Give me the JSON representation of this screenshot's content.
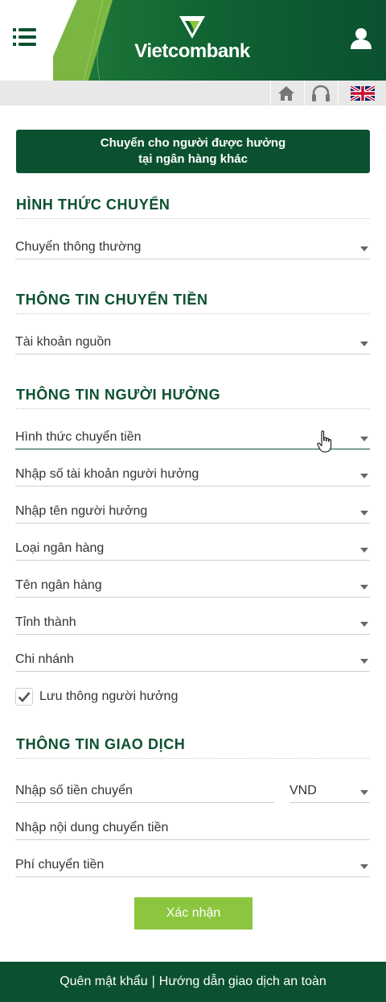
{
  "header": {
    "brand": "Vietcombank",
    "colors": {
      "primary_green": "#0b5130",
      "accent_green": "#8cc63e",
      "toolbar_gray": "#e8e8e8"
    },
    "icons": {
      "menu": "menu-list-icon",
      "user": "user-icon",
      "logo": "vietcombank-logo-mark"
    }
  },
  "toolbar": {
    "icons": {
      "home": "home-icon",
      "support": "headset-icon",
      "language": "uk-flag-icon"
    }
  },
  "page": {
    "title_line1": "Chuyển cho người được hưởng",
    "title_line2": "tại ngân hàng khác"
  },
  "sections": {
    "transfer_type": {
      "title": "HÌNH THỨC CHUYỂN",
      "select_value": "Chuyển thông thường"
    },
    "transfer_info": {
      "title": "THÔNG TIN CHUYỂN TIỀN",
      "source_account": "Tài khoản nguồn"
    },
    "beneficiary": {
      "title": "THÔNG TIN NGƯỜI HƯỞNG",
      "transfer_method": "Hình thức chuyển tiền",
      "account_number": "Nhập số tài khoản người hưởng",
      "name": "Nhập tên người hưởng",
      "bank_type": "Loại ngân hàng",
      "bank_name": "Tên ngân hàng",
      "province": "Tỉnh thành",
      "branch": "Chi nhánh",
      "save_label": "Lưu thông người hưởng",
      "save_checked": true
    },
    "transaction": {
      "title": "THÔNG TIN GIAO DỊCH",
      "amount_placeholder": "Nhập số tiền chuyển",
      "currency": "VND",
      "content_placeholder": "Nhập nội dung chuyển tiền",
      "fee": "Phí chuyển tiền"
    }
  },
  "actions": {
    "confirm": "Xác nhận"
  },
  "footer": {
    "forgot_password": "Quên mật khẩu",
    "separator": "|",
    "safety_guide": "Hướng dẫn giao dịch an toàn"
  }
}
